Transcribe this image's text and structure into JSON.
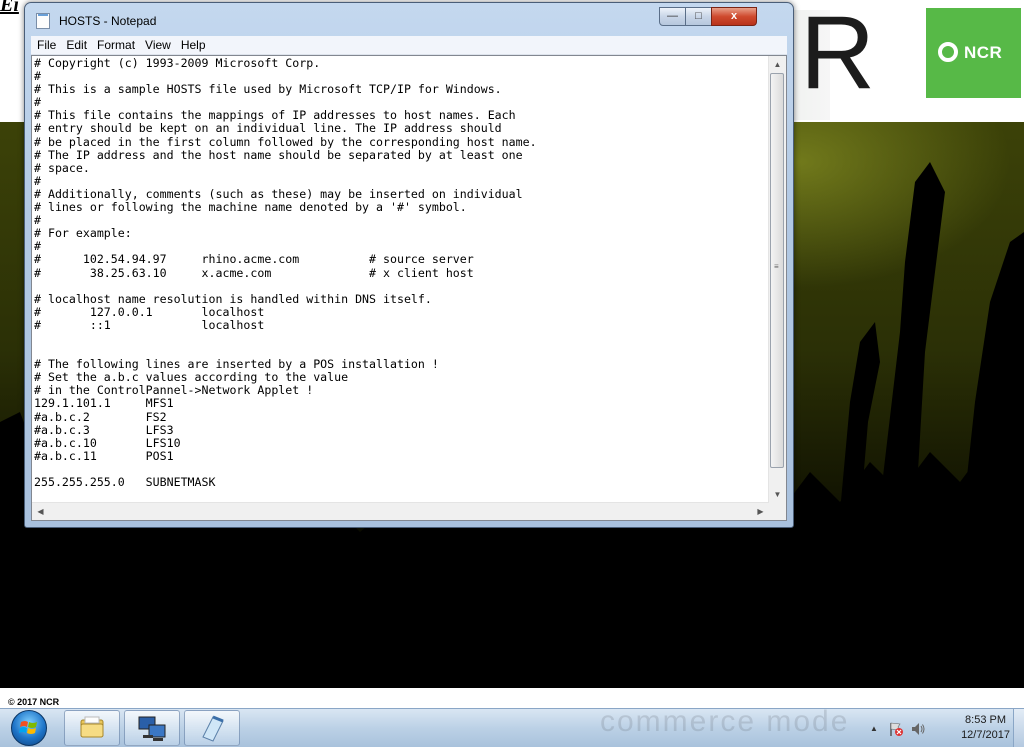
{
  "document": {
    "heading_partial": "Ei",
    "copyright": "© 2017 NCR",
    "brand_letter": "R",
    "brand_logo_text": "NCR",
    "taskbar_watermark": "commerce mode"
  },
  "window": {
    "title": "HOSTS - Notepad",
    "controls": {
      "minimize": "—",
      "maximize": "□",
      "close": "x"
    },
    "menu": [
      "File",
      "Edit",
      "Format",
      "View",
      "Help"
    ],
    "text_lines": [
      "# Copyright (c) 1993-2009 Microsoft Corp.",
      "#",
      "# This is a sample HOSTS file used by Microsoft TCP/IP for Windows.",
      "#",
      "# This file contains the mappings of IP addresses to host names. Each",
      "# entry should be kept on an individual line. The IP address should",
      "# be placed in the first column followed by the corresponding host name.",
      "# The IP address and the host name should be separated by at least one",
      "# space.",
      "#",
      "# Additionally, comments (such as these) may be inserted on individual",
      "# lines or following the machine name denoted by a '#' symbol.",
      "#",
      "# For example:",
      "#",
      "#      102.54.94.97     rhino.acme.com          # source server",
      "#       38.25.63.10     x.acme.com              # x client host",
      "",
      "# localhost name resolution is handled within DNS itself.",
      "#       127.0.0.1       localhost",
      "#       ::1             localhost",
      "",
      "",
      "# The following lines are inserted by a POS installation !",
      "# Set the a.b.c values according to the value",
      "# in the ControlPannel->Network Applet !",
      "129.1.101.1     MFS1",
      "#a.b.c.2        FS2",
      "#a.b.c.3        LFS3",
      "#a.b.c.10       LFS10",
      "#a.b.c.11       POS1",
      "",
      "255.255.255.0   SUBNETMASK"
    ]
  },
  "taskbar": {
    "start_icon": "windows-orb-icon",
    "pinned": [
      "explorer-folder-icon",
      "network-computer-icon",
      "notepad-icon"
    ],
    "tray_icons": [
      "show-hidden-icons-arrow",
      "action-center-flag-icon",
      "speaker-icon"
    ],
    "tray_arrow": "▲",
    "time": "8:53 PM",
    "date": "12/7/2017"
  },
  "colors": {
    "window_frame": "#b2c9e4",
    "close_button": "#cf4a2e",
    "brand_green": "#57b947",
    "taskbar": "#bcd1e6"
  }
}
